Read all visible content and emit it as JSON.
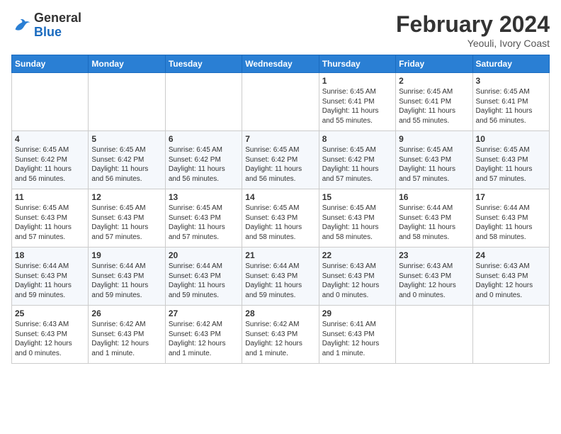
{
  "logo": {
    "text_general": "General",
    "text_blue": "Blue"
  },
  "header": {
    "month_year": "February 2024",
    "location": "Yeouli, Ivory Coast"
  },
  "weekdays": [
    "Sunday",
    "Monday",
    "Tuesday",
    "Wednesday",
    "Thursday",
    "Friday",
    "Saturday"
  ],
  "weeks": [
    [
      {
        "day": "",
        "content": ""
      },
      {
        "day": "",
        "content": ""
      },
      {
        "day": "",
        "content": ""
      },
      {
        "day": "",
        "content": ""
      },
      {
        "day": "1",
        "content": "Sunrise: 6:45 AM\nSunset: 6:41 PM\nDaylight: 11 hours\nand 55 minutes."
      },
      {
        "day": "2",
        "content": "Sunrise: 6:45 AM\nSunset: 6:41 PM\nDaylight: 11 hours\nand 55 minutes."
      },
      {
        "day": "3",
        "content": "Sunrise: 6:45 AM\nSunset: 6:41 PM\nDaylight: 11 hours\nand 56 minutes."
      }
    ],
    [
      {
        "day": "4",
        "content": "Sunrise: 6:45 AM\nSunset: 6:42 PM\nDaylight: 11 hours\nand 56 minutes."
      },
      {
        "day": "5",
        "content": "Sunrise: 6:45 AM\nSunset: 6:42 PM\nDaylight: 11 hours\nand 56 minutes."
      },
      {
        "day": "6",
        "content": "Sunrise: 6:45 AM\nSunset: 6:42 PM\nDaylight: 11 hours\nand 56 minutes."
      },
      {
        "day": "7",
        "content": "Sunrise: 6:45 AM\nSunset: 6:42 PM\nDaylight: 11 hours\nand 56 minutes."
      },
      {
        "day": "8",
        "content": "Sunrise: 6:45 AM\nSunset: 6:42 PM\nDaylight: 11 hours\nand 57 minutes."
      },
      {
        "day": "9",
        "content": "Sunrise: 6:45 AM\nSunset: 6:43 PM\nDaylight: 11 hours\nand 57 minutes."
      },
      {
        "day": "10",
        "content": "Sunrise: 6:45 AM\nSunset: 6:43 PM\nDaylight: 11 hours\nand 57 minutes."
      }
    ],
    [
      {
        "day": "11",
        "content": "Sunrise: 6:45 AM\nSunset: 6:43 PM\nDaylight: 11 hours\nand 57 minutes."
      },
      {
        "day": "12",
        "content": "Sunrise: 6:45 AM\nSunset: 6:43 PM\nDaylight: 11 hours\nand 57 minutes."
      },
      {
        "day": "13",
        "content": "Sunrise: 6:45 AM\nSunset: 6:43 PM\nDaylight: 11 hours\nand 57 minutes."
      },
      {
        "day": "14",
        "content": "Sunrise: 6:45 AM\nSunset: 6:43 PM\nDaylight: 11 hours\nand 58 minutes."
      },
      {
        "day": "15",
        "content": "Sunrise: 6:45 AM\nSunset: 6:43 PM\nDaylight: 11 hours\nand 58 minutes."
      },
      {
        "day": "16",
        "content": "Sunrise: 6:44 AM\nSunset: 6:43 PM\nDaylight: 11 hours\nand 58 minutes."
      },
      {
        "day": "17",
        "content": "Sunrise: 6:44 AM\nSunset: 6:43 PM\nDaylight: 11 hours\nand 58 minutes."
      }
    ],
    [
      {
        "day": "18",
        "content": "Sunrise: 6:44 AM\nSunset: 6:43 PM\nDaylight: 11 hours\nand 59 minutes."
      },
      {
        "day": "19",
        "content": "Sunrise: 6:44 AM\nSunset: 6:43 PM\nDaylight: 11 hours\nand 59 minutes."
      },
      {
        "day": "20",
        "content": "Sunrise: 6:44 AM\nSunset: 6:43 PM\nDaylight: 11 hours\nand 59 minutes."
      },
      {
        "day": "21",
        "content": "Sunrise: 6:44 AM\nSunset: 6:43 PM\nDaylight: 11 hours\nand 59 minutes."
      },
      {
        "day": "22",
        "content": "Sunrise: 6:43 AM\nSunset: 6:43 PM\nDaylight: 12 hours\nand 0 minutes."
      },
      {
        "day": "23",
        "content": "Sunrise: 6:43 AM\nSunset: 6:43 PM\nDaylight: 12 hours\nand 0 minutes."
      },
      {
        "day": "24",
        "content": "Sunrise: 6:43 AM\nSunset: 6:43 PM\nDaylight: 12 hours\nand 0 minutes."
      }
    ],
    [
      {
        "day": "25",
        "content": "Sunrise: 6:43 AM\nSunset: 6:43 PM\nDaylight: 12 hours\nand 0 minutes."
      },
      {
        "day": "26",
        "content": "Sunrise: 6:42 AM\nSunset: 6:43 PM\nDaylight: 12 hours\nand 1 minute."
      },
      {
        "day": "27",
        "content": "Sunrise: 6:42 AM\nSunset: 6:43 PM\nDaylight: 12 hours\nand 1 minute."
      },
      {
        "day": "28",
        "content": "Sunrise: 6:42 AM\nSunset: 6:43 PM\nDaylight: 12 hours\nand 1 minute."
      },
      {
        "day": "29",
        "content": "Sunrise: 6:41 AM\nSunset: 6:43 PM\nDaylight: 12 hours\nand 1 minute."
      },
      {
        "day": "",
        "content": ""
      },
      {
        "day": "",
        "content": ""
      }
    ]
  ]
}
